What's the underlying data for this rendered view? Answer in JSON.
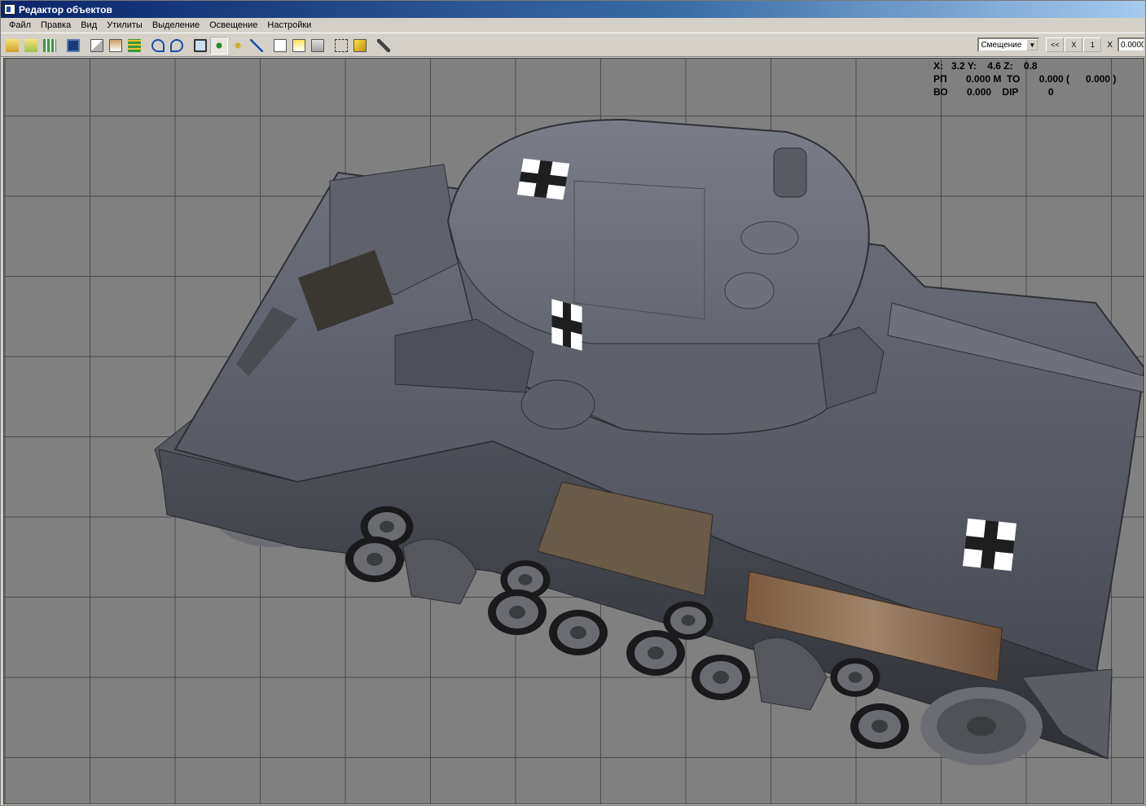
{
  "window": {
    "title": "Редактор объектов"
  },
  "menu": [
    "Файл",
    "Правка",
    "Вид",
    "Утилиты",
    "Выделение",
    "Освещение",
    "Настройки"
  ],
  "toolbar": {
    "mode_select": "Смещение",
    "btn_back": "<<",
    "btn_x": "X",
    "btn_1": "1",
    "axis_label": "X",
    "value": "0.0000"
  },
  "hud": {
    "row1": "X:   3.2 Y:    4.6 Z:    0.8",
    "row2": "РП       0.000 М  ТО       0.000 (      0.000 )",
    "row3": "ВО       0.000    DIP           0"
  },
  "colors": {
    "accent_title": "#0a246a",
    "viewport_bg": "#808080",
    "grid": "#4c4c4c"
  }
}
